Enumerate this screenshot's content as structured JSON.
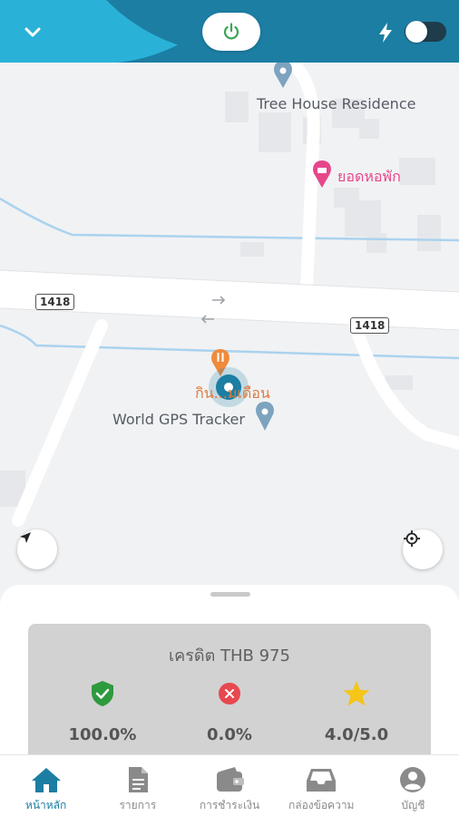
{
  "header": {
    "collapse_icon": "chevron-down-icon",
    "power_icon": "power-icon",
    "bolt_icon": "lightning-bolt-icon",
    "toggle_on": false,
    "colors": {
      "primary": "#1c7ea3",
      "accent": "#2ab1d8",
      "power_green": "#3aa655"
    }
  },
  "map": {
    "pois": {
      "tree_house": "Tree House Residence",
      "guesthouse": "ยอดหอพัก",
      "restaurant": "กิน...มเดือน",
      "tracker": "World GPS Tracker"
    },
    "road_shields": [
      "1418",
      "1418"
    ],
    "navigate_icon": "navigation-arrow-icon",
    "locate_icon": "crosshair-icon"
  },
  "sheet": {
    "credit": "เครดิต THB 975",
    "stats": [
      {
        "icon": "shield-check-icon",
        "color": "#2e9a3e",
        "value": "100.0%"
      },
      {
        "icon": "close-circle-icon",
        "color": "#e84850",
        "value": "0.0%"
      },
      {
        "icon": "star-icon",
        "color": "#f5c518",
        "value": "4.0/5.0"
      }
    ]
  },
  "nav": {
    "items": [
      {
        "label": "หน้าหลัก",
        "icon": "home-icon",
        "active": true
      },
      {
        "label": "รายการ",
        "icon": "document-icon",
        "active": false
      },
      {
        "label": "การชำระเงิน",
        "icon": "wallet-icon",
        "active": false
      },
      {
        "label": "กล่องข้อความ",
        "icon": "inbox-icon",
        "active": false
      },
      {
        "label": "บัญชี",
        "icon": "account-icon",
        "active": false
      }
    ]
  }
}
